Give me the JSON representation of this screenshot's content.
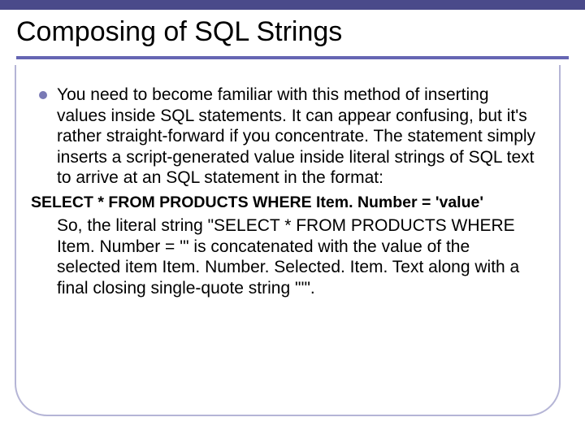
{
  "slide": {
    "title": "Composing of SQL Strings",
    "bullet1": "You need to become familiar with this method of inserting values inside SQL statements. It can appear confusing, but it's rather straight-forward if you concentrate. The statement simply inserts a script-generated value inside literal strings of SQL text to arrive at an SQL statement in the format:",
    "code": "SELECT * FROM PRODUCTS WHERE Item. Number = 'value'",
    "para2": "So, the literal string \"SELECT * FROM PRODUCTS WHERE Item. Number = '\" is concatenated with the value of the selected item Item. Number. Selected. Item. Text along with a final closing single-quote string \"'\"."
  }
}
